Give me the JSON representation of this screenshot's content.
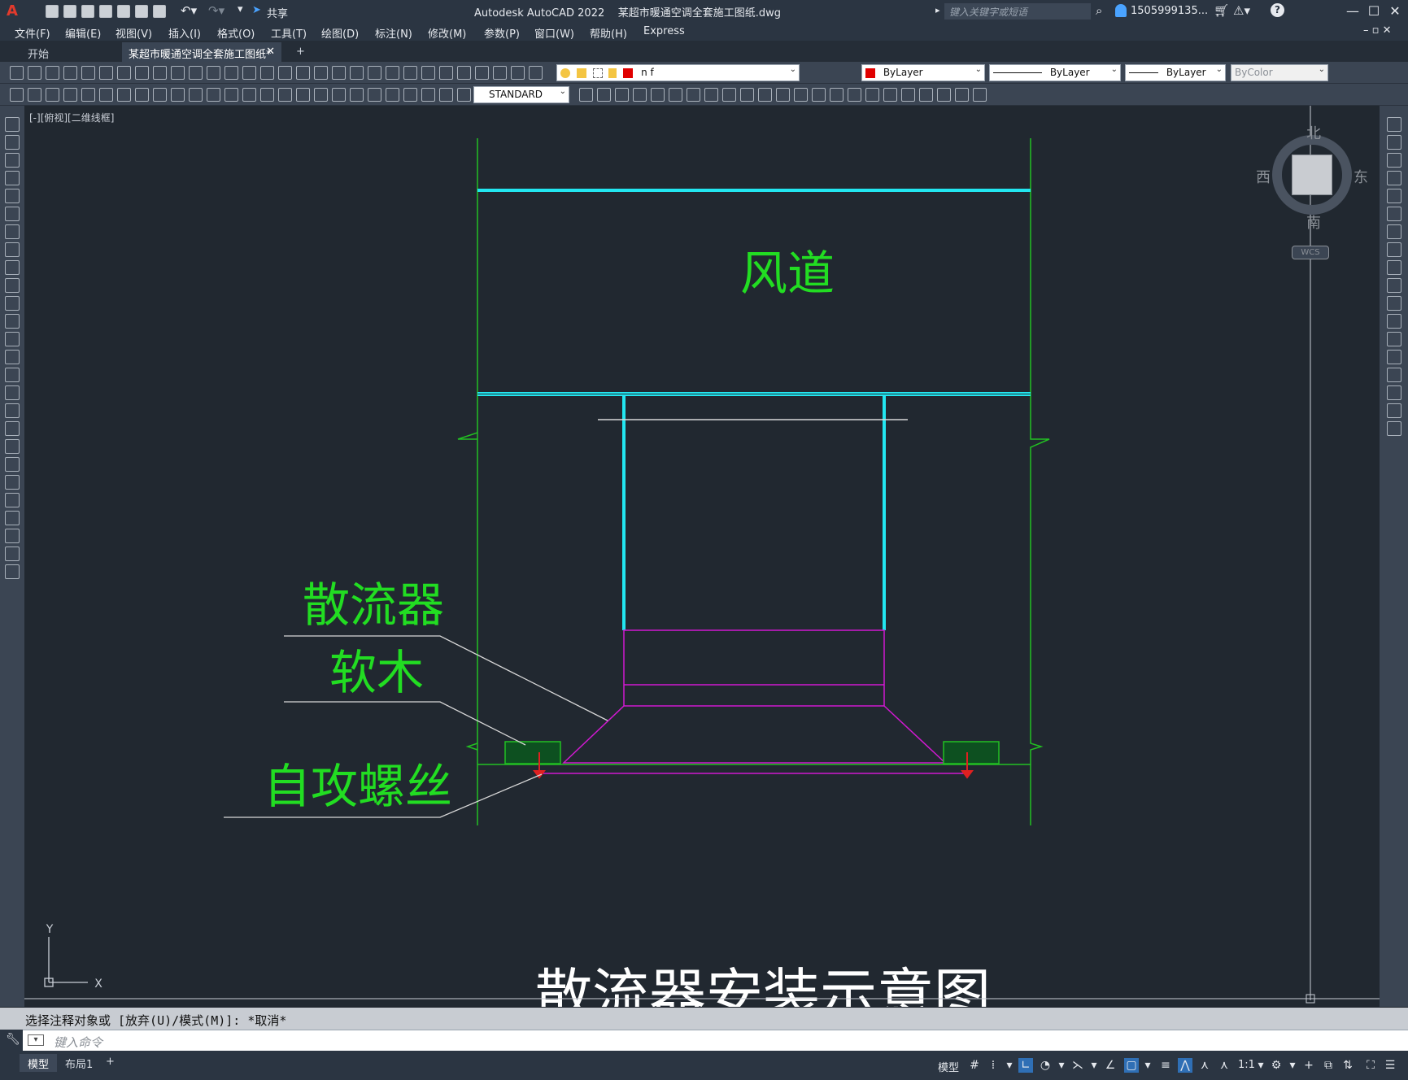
{
  "app": {
    "title": "Autodesk AutoCAD 2022    某超市暖通空调全套施工图纸.dwg",
    "share_label": "共享",
    "search_placeholder": "键入关键字或短语",
    "user_name": "1505999135...",
    "minimize": "—",
    "maximize": "☐",
    "close": "✕"
  },
  "menu": [
    "文件(F)",
    "编辑(E)",
    "视图(V)",
    "插入(I)",
    "格式(O)",
    "工具(T)",
    "绘图(D)",
    "标注(N)",
    "修改(M)",
    "参数(P)",
    "窗口(W)",
    "帮助(H)",
    "Express"
  ],
  "tabs": {
    "start": "开始",
    "active": "某超市暖通空调全套施工图纸*",
    "close": "✕",
    "add": "+"
  },
  "toolbar": {
    "layer_value": "n f",
    "color_value": "ByLayer",
    "linetype_value": "ByLayer",
    "lineweight_value": "ByLayer",
    "plotstyle_value": "ByColor",
    "textstyle_value": "STANDARD"
  },
  "viewport": {
    "label": "[-][俯视][二维线框]",
    "viewcube": {
      "north": "北",
      "south": "南",
      "east": "东",
      "west": "西",
      "wcs": "WCS"
    },
    "ucs": {
      "x": "X",
      "y": "Y"
    }
  },
  "drawing": {
    "labels": {
      "duct": "风道",
      "diffuser": "散流器",
      "cork": "软木",
      "screw": "自攻螺丝",
      "title": "散流器安装示意图"
    },
    "colors": {
      "wall": "#22c022",
      "cyan": "#22e6f0",
      "magenta": "#d019d0",
      "text": "#22dd22",
      "leader": "#d8d8d8",
      "red": "#e02020"
    }
  },
  "command": {
    "history": "选择注释对象或 [放弃(U)/模式(M)]: *取消*",
    "placeholder": "键入命令"
  },
  "status": {
    "tab_model": "模型",
    "tab_layout1": "布局1",
    "tab_add": "+",
    "model_btn": "模型",
    "scale": "1:1"
  }
}
